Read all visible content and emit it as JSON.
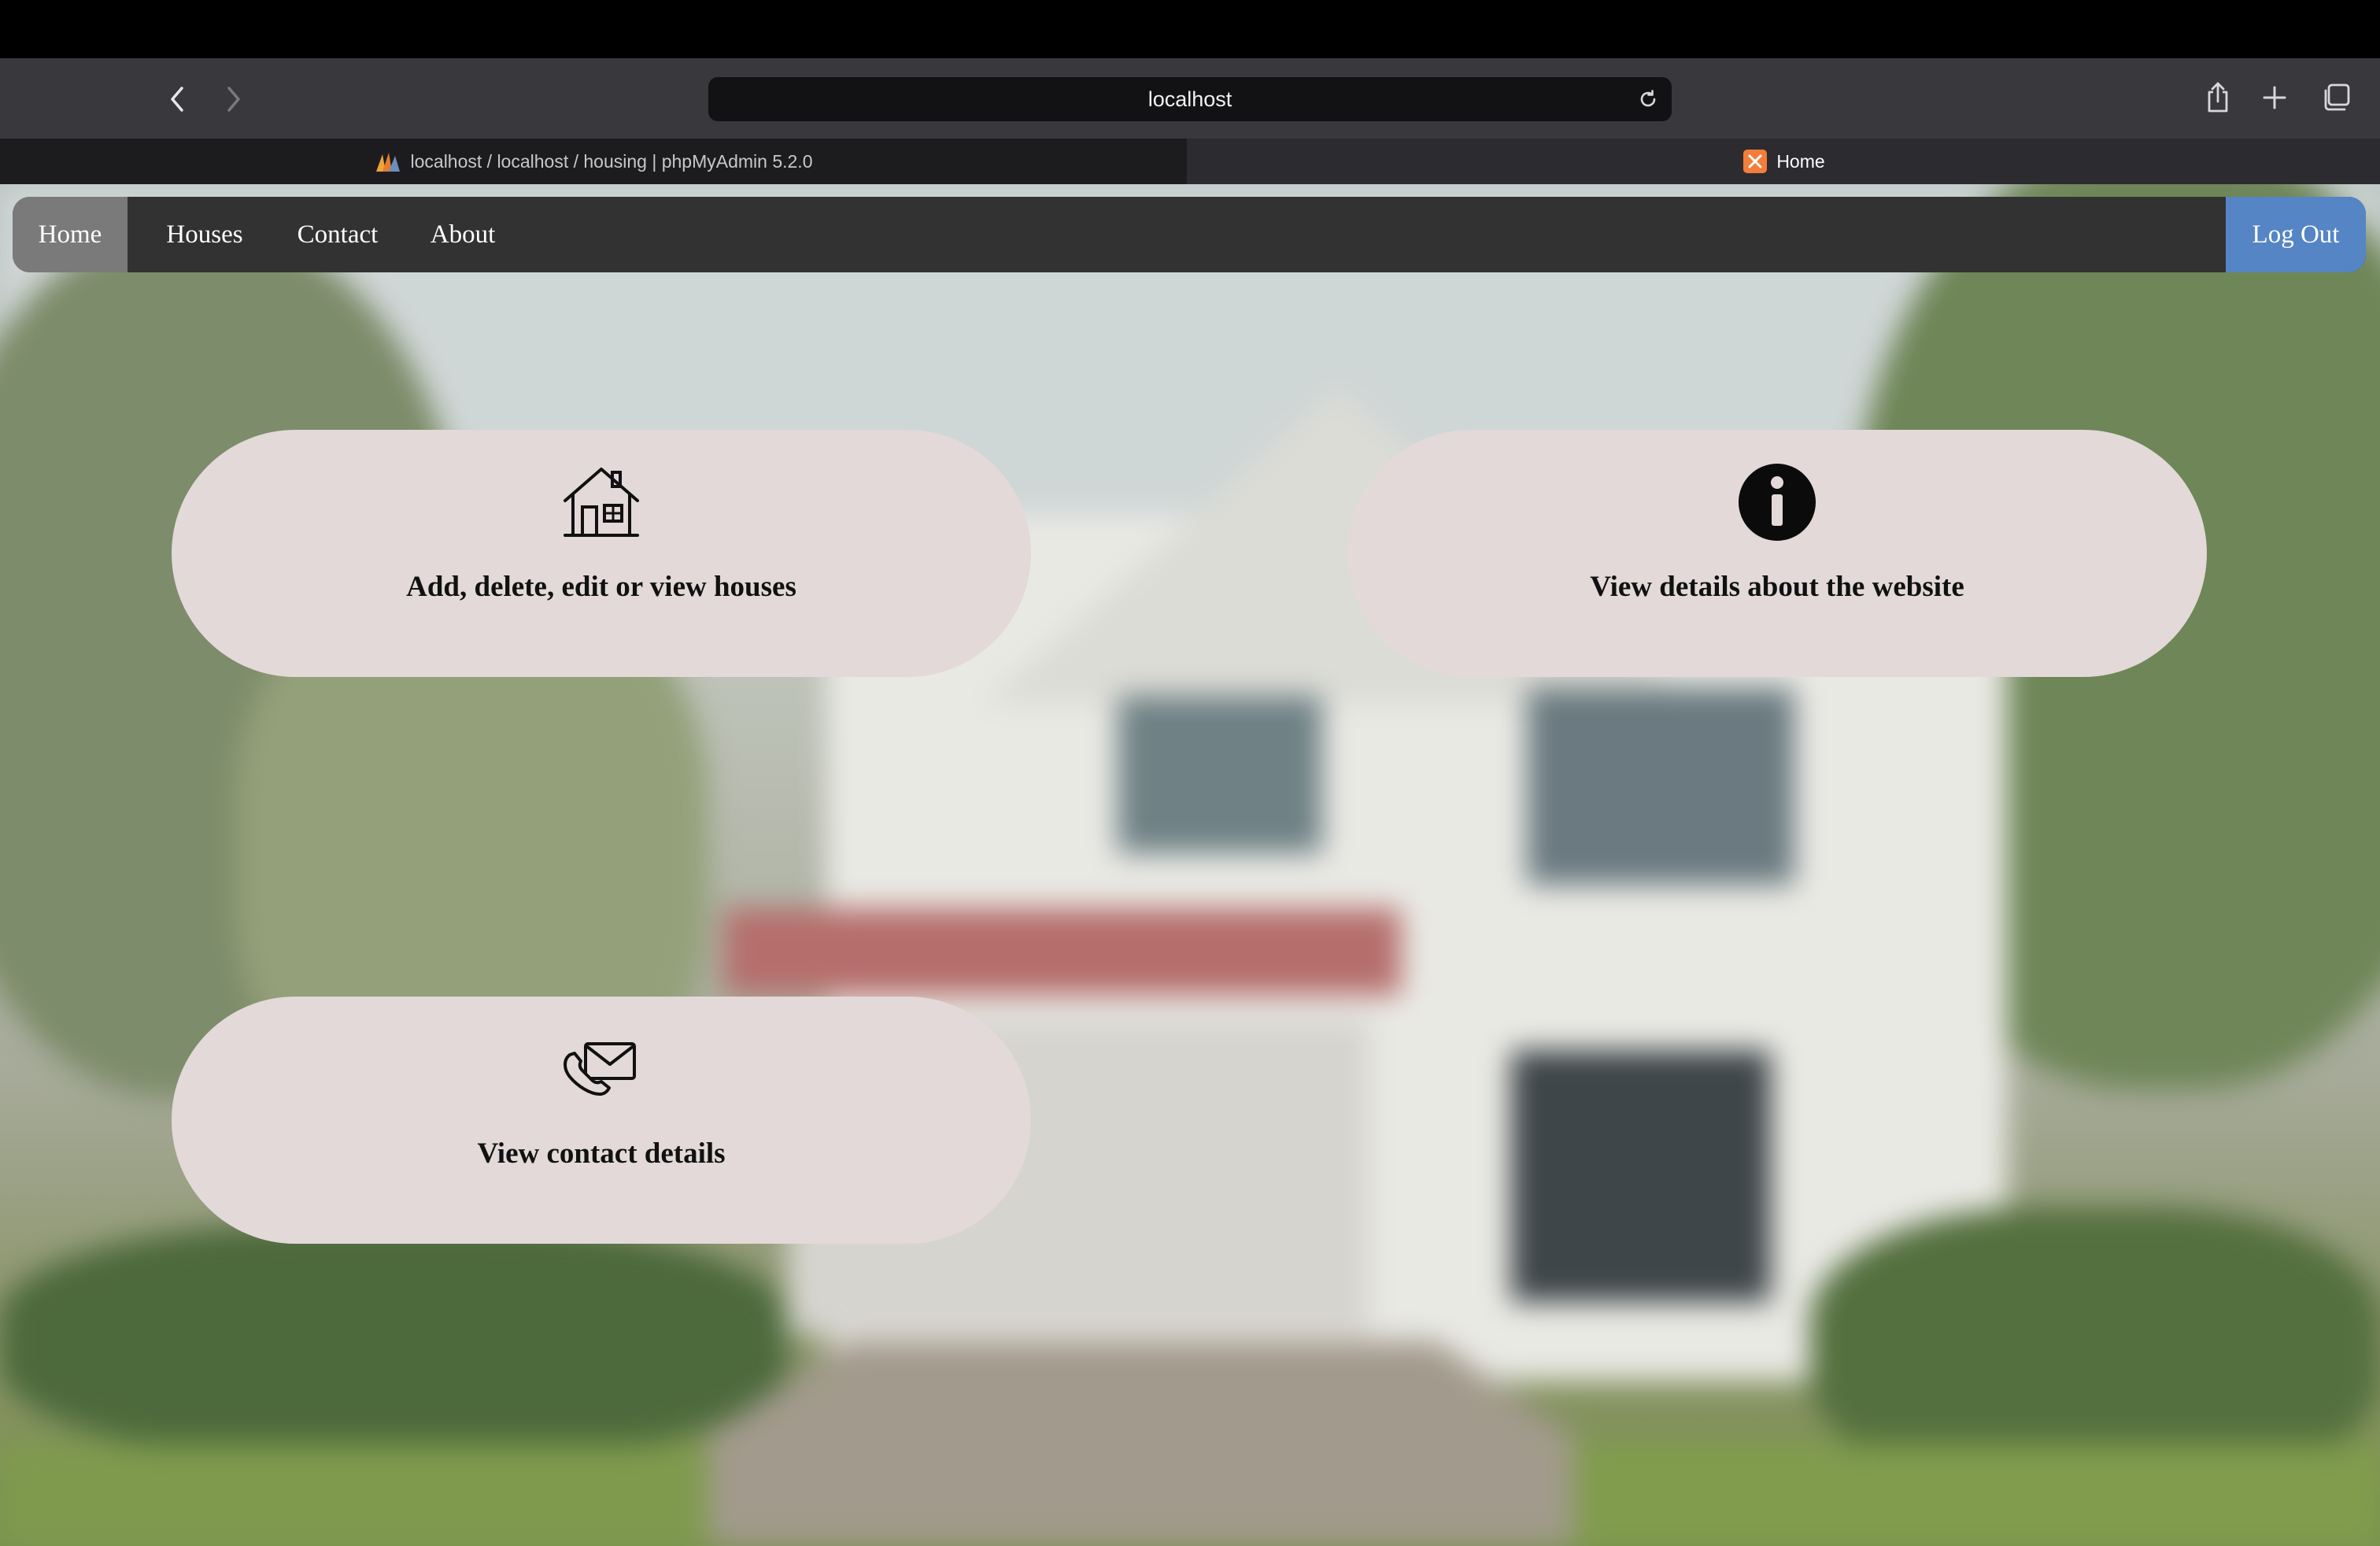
{
  "browser": {
    "url": "localhost",
    "tabs": [
      {
        "label": "localhost / localhost / housing | phpMyAdmin 5.2.0",
        "favicon": "phpmyadmin-icon",
        "active": false
      },
      {
        "label": "Home",
        "favicon": "xampp-icon",
        "active": true
      }
    ],
    "toolbar_icons": [
      "back-icon",
      "forward-icon",
      "reload-icon",
      "share-icon",
      "new-tab-icon",
      "tab-overview-icon"
    ]
  },
  "navbar": {
    "items": [
      "Home",
      "Houses",
      "Contact",
      "About"
    ],
    "active": "Home",
    "logout_label": "Log Out",
    "colors": {
      "bar": "#323232",
      "active": "#7a7a7a",
      "logout": "#5585c4"
    }
  },
  "cards": [
    {
      "icon": "house-icon",
      "label": "Add, delete, edit or view houses"
    },
    {
      "icon": "info-icon",
      "label": "View details about the website"
    },
    {
      "icon": "contact-mail-icon",
      "label": "View contact details"
    }
  ],
  "theme": {
    "card_background": "#e2d9d8"
  }
}
